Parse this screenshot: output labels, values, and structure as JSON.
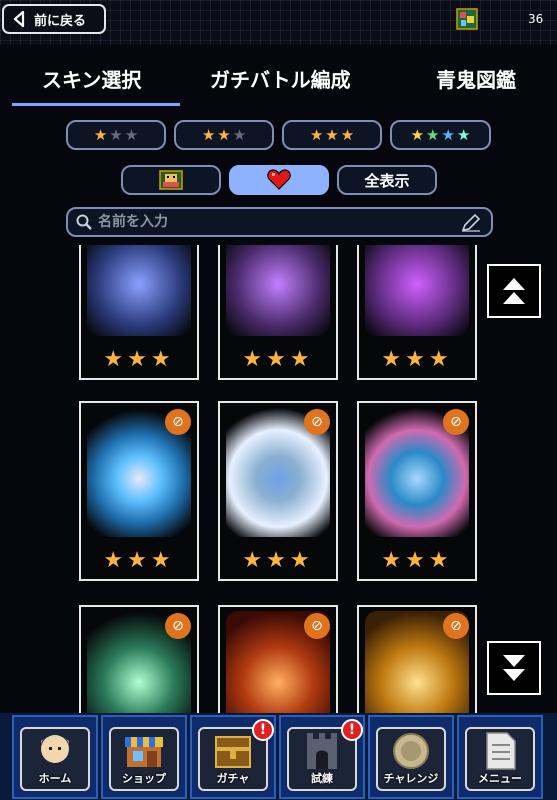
{
  "header": {
    "back_label": "前に戻る",
    "currency_icon": "ticket-icon",
    "currency_count": "36"
  },
  "tabs": [
    {
      "label": "スキン選択",
      "active": true
    },
    {
      "label": "ガチバトル編成",
      "active": false
    },
    {
      "label": "青鬼図鑑",
      "active": false
    }
  ],
  "rarity_filters": [
    {
      "filled": 1,
      "total": 3,
      "rainbow": false
    },
    {
      "filled": 2,
      "total": 3,
      "rainbow": false
    },
    {
      "filled": 3,
      "total": 3,
      "rainbow": false
    },
    {
      "filled": 4,
      "total": 4,
      "rainbow": true
    }
  ],
  "view_filters": {
    "icon_filter": "character-icon",
    "favorite_filter": "heart-icon",
    "show_all_label": "全表示",
    "active": "favorite"
  },
  "search": {
    "placeholder": "名前を入力",
    "value": ""
  },
  "skins": [
    {
      "stars": "★★★",
      "favorite": true,
      "bg": "#3b4a8a"
    },
    {
      "stars": "★★★",
      "favorite": true,
      "bg": "#4a2a6a"
    },
    {
      "stars": "★★★",
      "favorite": true,
      "bg": "#5a2a7a"
    },
    {
      "stars": "★★★",
      "favorite": true,
      "bg": "#1f6fae"
    },
    {
      "stars": "★★★",
      "favorite": true,
      "bg": "#6fa0c8"
    },
    {
      "stars": "★★★",
      "favorite": true,
      "bg": "#2a8ac8"
    },
    {
      "stars": "",
      "favorite": true,
      "bg": "#2a7a5a"
    },
    {
      "stars": "",
      "favorite": true,
      "bg": "#b03a10"
    },
    {
      "stars": "",
      "favorite": true,
      "bg": "#c07a10"
    }
  ],
  "nav": [
    {
      "label": "ホーム",
      "icon": "home-icon",
      "badge": ""
    },
    {
      "label": "ショップ",
      "icon": "shop-icon",
      "badge": ""
    },
    {
      "label": "ガチャ",
      "icon": "gacha-icon",
      "badge": "!"
    },
    {
      "label": "試練",
      "icon": "trial-icon",
      "badge": "!"
    },
    {
      "label": "チャレンジ",
      "icon": "challenge-icon",
      "badge": ""
    },
    {
      "label": "メニュー",
      "icon": "menu-icon",
      "badge": ""
    }
  ],
  "colors": {
    "accent": "#7aa7ff",
    "star": "#ffb53d",
    "badge": "#e02020"
  }
}
